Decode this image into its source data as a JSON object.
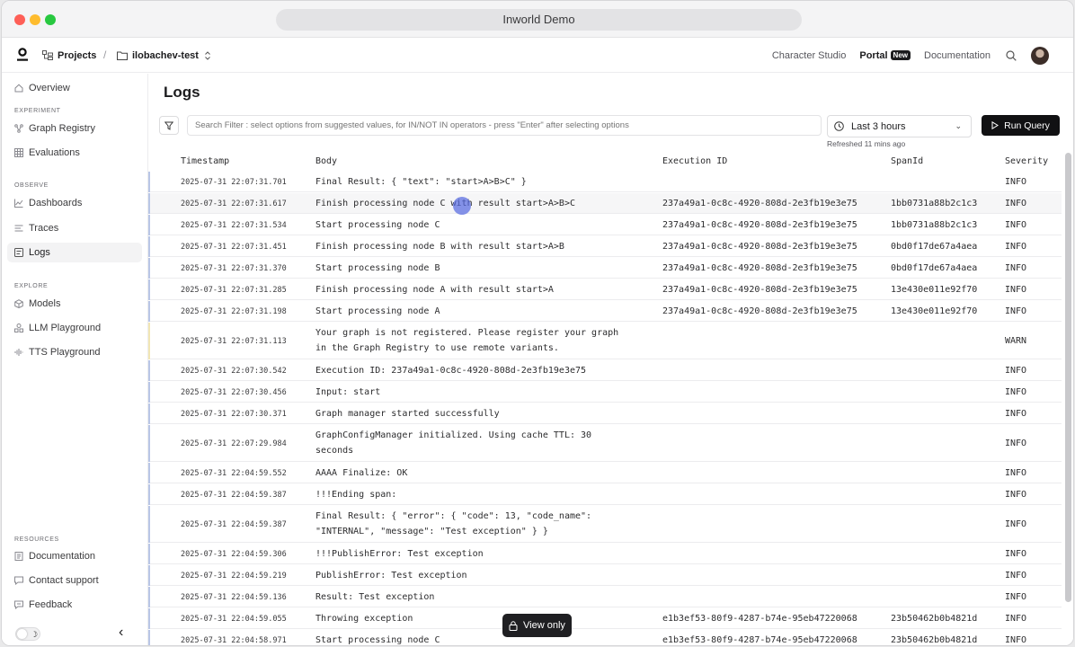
{
  "window": {
    "title": "Inworld Demo"
  },
  "header": {
    "projects_label": "Projects",
    "project_name": "ilobachev-test",
    "nav": {
      "character_studio": "Character Studio",
      "portal": "Portal",
      "portal_badge": "New",
      "documentation": "Documentation"
    }
  },
  "sidebar": {
    "overview": "Overview",
    "section_experiment": "EXPERIMENT",
    "graph_registry": "Graph Registry",
    "evaluations": "Evaluations",
    "section_observe": "OBSERVE",
    "dashboards": "Dashboards",
    "traces": "Traces",
    "logs": "Logs",
    "section_explore": "EXPLORE",
    "models": "Models",
    "llm_playground": "LLM Playground",
    "tts_playground": "TTS Playground",
    "section_resources": "RESOURCES",
    "documentation": "Documentation",
    "contact_support": "Contact support",
    "feedback": "Feedback"
  },
  "main": {
    "title": "Logs",
    "search_placeholder": "Search Filter : select options from suggested values, for IN/NOT IN operators - press \"Enter\" after selecting options",
    "time_range": "Last 3 hours",
    "refreshed": "Refreshed 11 mins ago",
    "run_query": "Run Query",
    "view_only": "View only"
  },
  "table": {
    "columns": {
      "timestamp": "Timestamp",
      "body": "Body",
      "execution_id": "Execution ID",
      "span_id": "SpanId",
      "severity": "Severity"
    },
    "rows": [
      {
        "ts": "2025-07-31 22:07:31.701",
        "body": [
          "Final Result: { \"text\": \"start>A>B>C\" }"
        ],
        "exec": "",
        "span": "",
        "sev": "INFO"
      },
      {
        "ts": "2025-07-31 22:07:31.617",
        "body": [
          "Finish processing node C with result start>A>B>C"
        ],
        "exec": "237a49a1-0c8c-4920-808d-2e3fb19e3e75",
        "span": "1bb0731a88b2c1c3",
        "sev": "INFO"
      },
      {
        "ts": "2025-07-31 22:07:31.534",
        "body": [
          "Start processing node C"
        ],
        "exec": "237a49a1-0c8c-4920-808d-2e3fb19e3e75",
        "span": "1bb0731a88b2c1c3",
        "sev": "INFO"
      },
      {
        "ts": "2025-07-31 22:07:31.451",
        "body": [
          "Finish processing node B with result start>A>B"
        ],
        "exec": "237a49a1-0c8c-4920-808d-2e3fb19e3e75",
        "span": "0bd0f17de67a4aea",
        "sev": "INFO"
      },
      {
        "ts": "2025-07-31 22:07:31.370",
        "body": [
          "Start processing node B"
        ],
        "exec": "237a49a1-0c8c-4920-808d-2e3fb19e3e75",
        "span": "0bd0f17de67a4aea",
        "sev": "INFO"
      },
      {
        "ts": "2025-07-31 22:07:31.285",
        "body": [
          "Finish processing node A with result start>A"
        ],
        "exec": "237a49a1-0c8c-4920-808d-2e3fb19e3e75",
        "span": "13e430e011e92f70",
        "sev": "INFO"
      },
      {
        "ts": "2025-07-31 22:07:31.198",
        "body": [
          "Start processing node A"
        ],
        "exec": "237a49a1-0c8c-4920-808d-2e3fb19e3e75",
        "span": "13e430e011e92f70",
        "sev": "INFO"
      },
      {
        "ts": "2025-07-31 22:07:31.113",
        "body": [
          "Your graph is not registered. Please register your graph",
          "in the Graph Registry to use remote variants."
        ],
        "exec": "",
        "span": "",
        "sev": "WARN"
      },
      {
        "ts": "2025-07-31 22:07:30.542",
        "body": [
          "Execution ID: 237a49a1-0c8c-4920-808d-2e3fb19e3e75"
        ],
        "exec": "",
        "span": "",
        "sev": "INFO"
      },
      {
        "ts": "2025-07-31 22:07:30.456",
        "body": [
          "Input: start"
        ],
        "exec": "",
        "span": "",
        "sev": "INFO"
      },
      {
        "ts": "2025-07-31 22:07:30.371",
        "body": [
          "Graph manager started successfully"
        ],
        "exec": "",
        "span": "",
        "sev": "INFO"
      },
      {
        "ts": "2025-07-31 22:07:29.984",
        "body": [
          "GraphConfigManager initialized. Using cache TTL: 30",
          "seconds"
        ],
        "exec": "",
        "span": "",
        "sev": "INFO"
      },
      {
        "ts": "2025-07-31 22:04:59.552",
        "body": [
          "AAAA Finalize: OK"
        ],
        "exec": "",
        "span": "",
        "sev": "INFO"
      },
      {
        "ts": "2025-07-31 22:04:59.387",
        "body": [
          "!!!Ending span:"
        ],
        "exec": "",
        "span": "",
        "sev": "INFO"
      },
      {
        "ts": "2025-07-31 22:04:59.387",
        "body": [
          "Final Result: { \"error\": { \"code\": 13, \"code_name\":",
          "\"INTERNAL\", \"message\": \"Test exception\" } }"
        ],
        "exec": "",
        "span": "",
        "sev": "INFO"
      },
      {
        "ts": "2025-07-31 22:04:59.306",
        "body": [
          "!!!PublishError: Test exception"
        ],
        "exec": "",
        "span": "",
        "sev": "INFO"
      },
      {
        "ts": "2025-07-31 22:04:59.219",
        "body": [
          "PublishError: Test exception"
        ],
        "exec": "",
        "span": "",
        "sev": "INFO"
      },
      {
        "ts": "2025-07-31 22:04:59.136",
        "body": [
          "Result: Test exception"
        ],
        "exec": "",
        "span": "",
        "sev": "INFO"
      },
      {
        "ts": "2025-07-31 22:04:59.055",
        "body": [
          "Throwing exception"
        ],
        "exec": "e1b3ef53-80f9-4287-b74e-95eb47220068",
        "span": "23b50462b0b4821d",
        "sev": "INFO"
      },
      {
        "ts": "2025-07-31 22:04:58.971",
        "body": [
          "Start processing node C"
        ],
        "exec": "e1b3ef53-80f9-4287-b74e-95eb47220068",
        "span": "23b50462b0b4821d",
        "sev": "INFO"
      }
    ]
  },
  "colors": {
    "accent": "#111113",
    "row_bar": "#b9c6e6",
    "warn_bar": "#f1e6b5",
    "cursor": "#5366df"
  }
}
